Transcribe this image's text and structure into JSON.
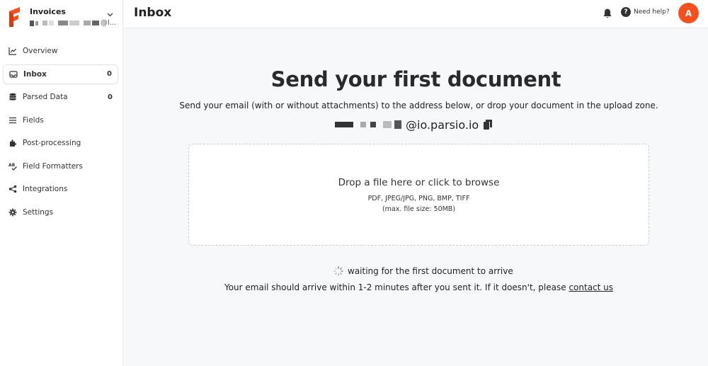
{
  "workspace": {
    "name": "Invoices",
    "email_suffix": "@l..."
  },
  "sidebar": {
    "items": [
      {
        "label": "Overview",
        "icon": "chart-line-icon",
        "count": ""
      },
      {
        "label": "Inbox",
        "icon": "inbox-icon",
        "count": "0",
        "active": true
      },
      {
        "label": "Parsed Data",
        "icon": "database-icon",
        "count": "0"
      },
      {
        "label": "Fields",
        "icon": "list-icon",
        "count": ""
      },
      {
        "label": "Post-processing",
        "icon": "puzzle-icon",
        "count": ""
      },
      {
        "label": "Field Formatters",
        "icon": "spellcheck-icon",
        "count": ""
      },
      {
        "label": "Integrations",
        "icon": "share-nodes-icon",
        "count": ""
      },
      {
        "label": "Settings",
        "icon": "gear-icon",
        "count": ""
      }
    ]
  },
  "header": {
    "title": "Inbox",
    "help_label": "Need help?",
    "help_glyph": "?",
    "avatar_initial": "A"
  },
  "main": {
    "headline": "Send your first document",
    "instructions": "Send your email (with or without attachments) to the address below, or drop your document in the upload zone.",
    "email_domain": "@io.parsio.io",
    "dropzone": {
      "title": "Drop a file here or click to browse",
      "types": "PDF, JPEG/JPG, PNG, BMP, TIFF",
      "max_size": "(max. file size: 50MB)"
    },
    "waiting_text": "waiting for the first document to arrive",
    "note_text": "Your email should arrive within 1-2 minutes after you sent it. If it doesn't, please ",
    "contact_link": "contact us"
  },
  "colors": {
    "brand": "#f4511e",
    "avatar_bg": "#f4511e",
    "text": "#222222",
    "main_bg": "#f6f8fa"
  }
}
